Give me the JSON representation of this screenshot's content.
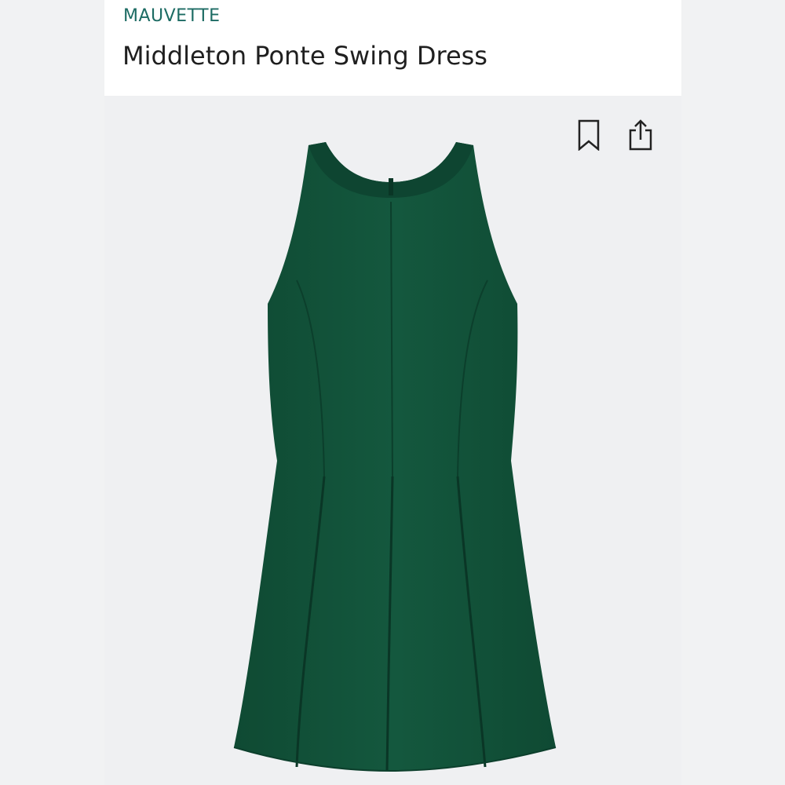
{
  "product": {
    "brand": "MAUVETTE",
    "name": "Middleton Ponte Swing Dress"
  },
  "actions": {
    "bookmark_icon": "bookmark-icon",
    "share_icon": "share-icon"
  },
  "colors": {
    "brand_text": "#1c6b63",
    "dress": "#13563c"
  }
}
